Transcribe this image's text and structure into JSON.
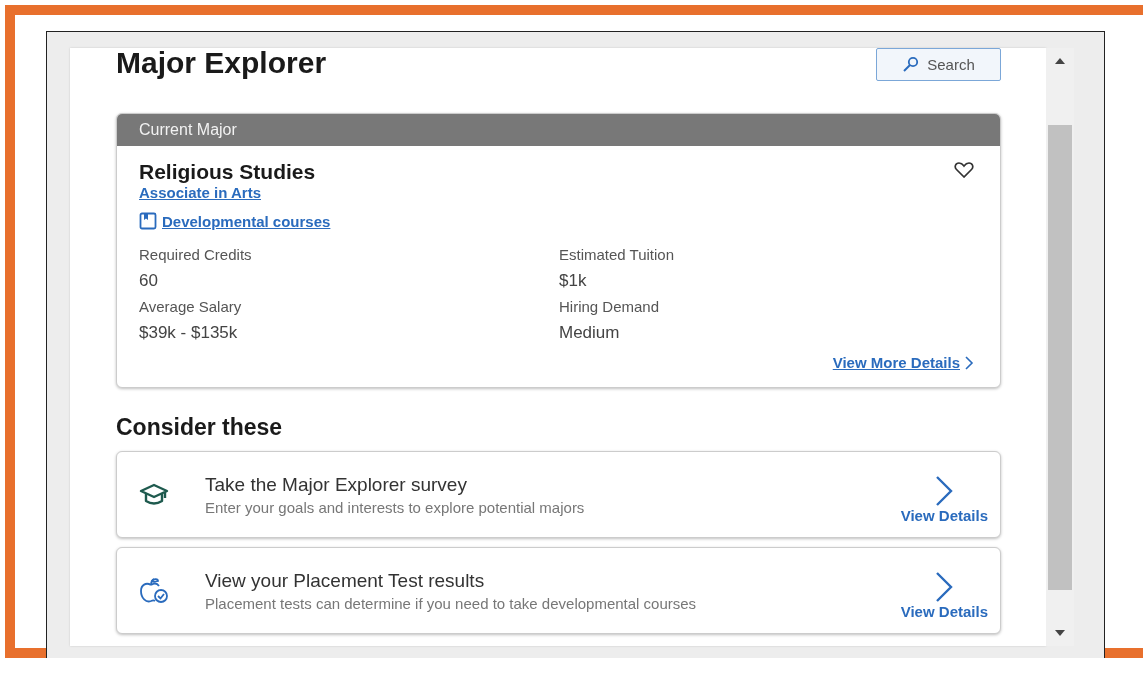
{
  "page": {
    "title": "Major Explorer",
    "search_button": "Search"
  },
  "current_major": {
    "header": "Current Major",
    "name": "Religious Studies",
    "degree_link": "Associate in Arts",
    "developmental_link": "Developmental courses",
    "favorited": false,
    "stats": [
      {
        "label": "Required Credits",
        "value": "60"
      },
      {
        "label": "Estimated Tuition",
        "value": "$1k"
      },
      {
        "label": "Average Salary",
        "value": "$39k - $135k"
      },
      {
        "label": "Hiring Demand",
        "value": "Medium"
      }
    ],
    "more_link": "View More Details"
  },
  "consider": {
    "heading": "Consider these",
    "items": [
      {
        "kind": "survey",
        "title": "Take the Major Explorer survey",
        "description": "Enter your goals and interests to explore potential majors",
        "action": "View Details"
      },
      {
        "kind": "placement",
        "title": "View your Placement Test results",
        "description": "Placement tests can determine if you need to take developmental courses",
        "action": "View Details"
      }
    ]
  }
}
